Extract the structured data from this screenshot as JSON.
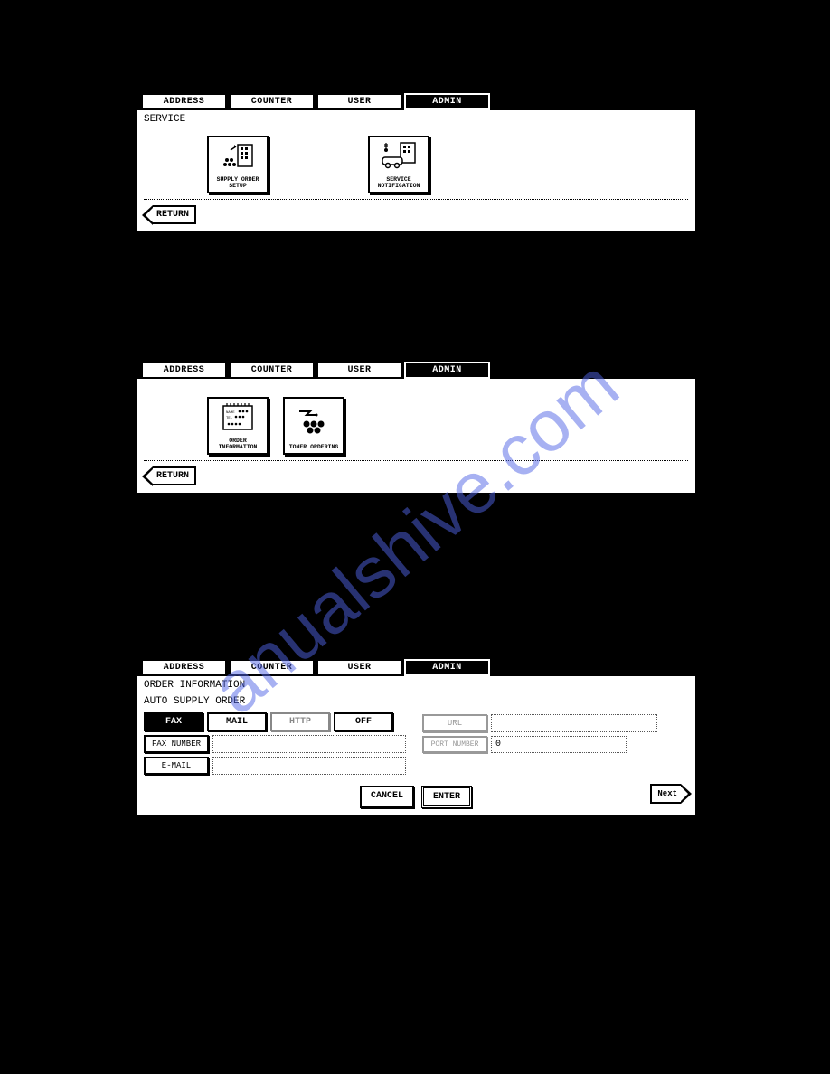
{
  "watermark": "anualshive.com",
  "tabs": {
    "address": "ADDRESS",
    "counter": "COUNTER",
    "user": "USER",
    "admin": "ADMIN"
  },
  "return": "RETURN",
  "panel1": {
    "title": "SERVICE",
    "icons": {
      "supply": "SUPPLY ORDER SETUP",
      "service": "SERVICE\nNOTIFICATION"
    }
  },
  "panel2": {
    "icons": {
      "order": "ORDER\nINFORMATION",
      "toner": "TONER ORDERING"
    }
  },
  "panel3": {
    "title1": "ORDER INFORMATION",
    "title2": "AUTO SUPPLY ORDER",
    "modes": {
      "fax": "FAX",
      "mail": "MAIL",
      "http": "HTTP",
      "off": "OFF"
    },
    "fields": {
      "faxnum": "FAX NUMBER",
      "email": "E-MAIL",
      "url": "URL",
      "port": "PORT NUMBER"
    },
    "values": {
      "faxnum": "",
      "email": "",
      "url": "",
      "port": "0"
    },
    "actions": {
      "cancel": "CANCEL",
      "enter": "ENTER",
      "next": "Next"
    }
  }
}
